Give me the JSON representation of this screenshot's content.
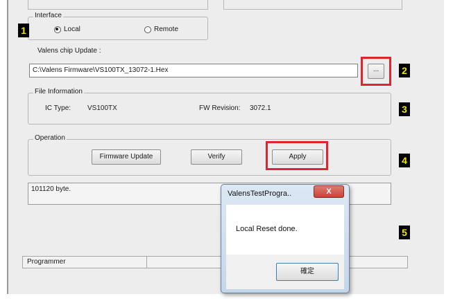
{
  "interface": {
    "legend": "Interface",
    "local": "Local",
    "remote": "Remote",
    "selected": "Local"
  },
  "chip_update": {
    "label": "Valens chip Update :",
    "path": "C:\\Valens Firmware\\VS100TX_13072-1.Hex",
    "browse": "..."
  },
  "file_info": {
    "legend": "File Information",
    "ic_type_label": "IC Type:",
    "ic_type": "VS100TX",
    "fw_revision_label": "FW Revision:",
    "fw_revision": "3072.1"
  },
  "operation": {
    "legend": "Operation",
    "firmware_update": "Firmware Update",
    "verify": "Verify",
    "apply": "Apply"
  },
  "log": {
    "text": "101120 byte."
  },
  "status": {
    "programmer": "Programmer"
  },
  "dialog": {
    "title": "ValensTestProgra..",
    "close": "X",
    "message": "Local Reset done.",
    "ok": "確定"
  },
  "markers": [
    "1",
    "2",
    "3",
    "4",
    "5"
  ],
  "colors": {
    "highlight": "#e0242c",
    "marker_bg": "#000000",
    "marker_text": "#f2e600",
    "dialog_close": "#c8433a"
  }
}
